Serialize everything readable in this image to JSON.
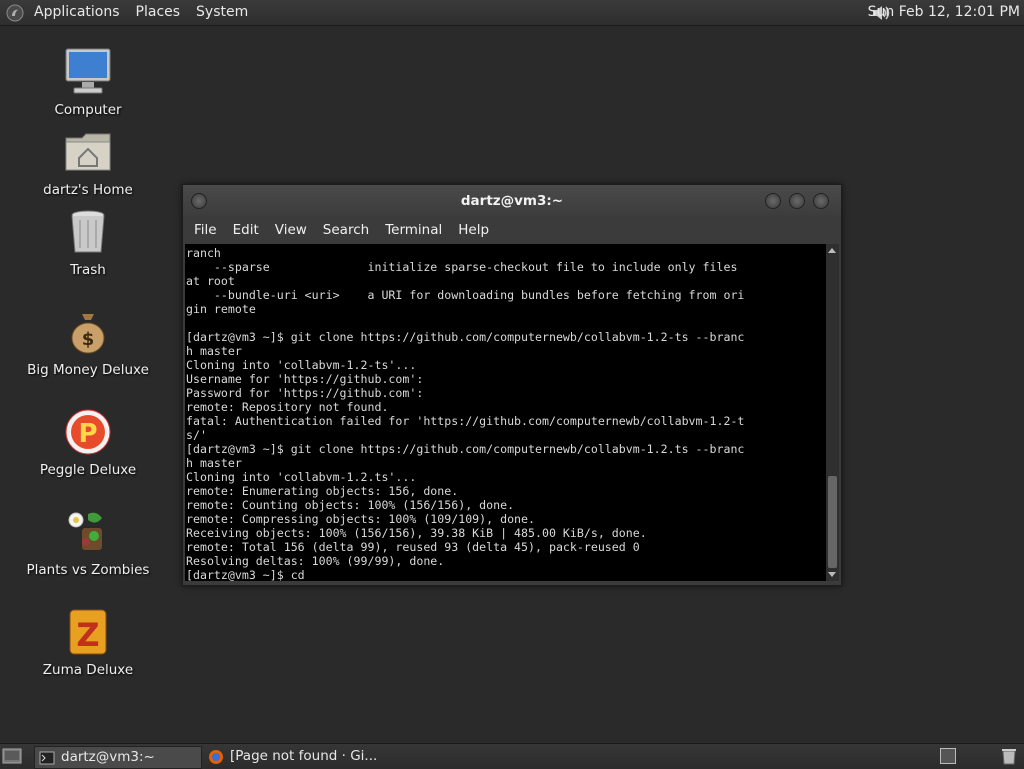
{
  "top_panel": {
    "menus": [
      "Applications",
      "Places",
      "System"
    ],
    "clock": "Sun Feb 12, 12:01 PM"
  },
  "desktop_icons": [
    {
      "label": "Computer",
      "icon": "computer-icon"
    },
    {
      "label": "dartz's Home",
      "icon": "home-folder-icon"
    },
    {
      "label": "Trash",
      "icon": "trash-icon"
    },
    {
      "label": "Big Money Deluxe",
      "icon": "money-bag-icon"
    },
    {
      "label": "Peggle Deluxe",
      "icon": "peggle-icon"
    },
    {
      "label": "Plants vs Zombies",
      "icon": "plants-icon"
    },
    {
      "label": "Zuma Deluxe",
      "icon": "zuma-icon"
    }
  ],
  "terminal": {
    "title": "dartz@vm3:~",
    "menus": [
      "File",
      "Edit",
      "View",
      "Search",
      "Terminal",
      "Help"
    ],
    "lines": [
      "ranch",
      "    --sparse              initialize sparse-checkout file to include only files",
      "at root",
      "    --bundle-uri <uri>    a URI for downloading bundles before fetching from ori",
      "gin remote",
      "",
      "[dartz@vm3 ~]$ git clone https://github.com/computernewb/collabvm-1.2-ts --branc",
      "h master",
      "Cloning into 'collabvm-1.2-ts'...",
      "Username for 'https://github.com':",
      "Password for 'https://github.com':",
      "remote: Repository not found.",
      "fatal: Authentication failed for 'https://github.com/computernewb/collabvm-1.2-t",
      "s/'",
      "[dartz@vm3 ~]$ git clone https://github.com/computernewb/collabvm-1.2.ts --branc",
      "h master",
      "Cloning into 'collabvm-1.2.ts'...",
      "remote: Enumerating objects: 156, done.",
      "remote: Counting objects: 100% (156/156), done.",
      "remote: Compressing objects: 100% (109/109), done.",
      "Receiving objects: 100% (156/156), 39.38 KiB | 485.00 KiB/s, done.",
      "remote: Total 156 (delta 99), reused 93 (delta 45), pack-reused 0",
      "Resolving deltas: 100% (99/99), done.",
      "[dartz@vm3 ~]$ cd"
    ]
  },
  "taskbar": {
    "tasks": [
      {
        "label": "dartz@vm3:~",
        "icon": "terminal-icon",
        "active": true
      },
      {
        "label": "[Page not found · Gi...",
        "icon": "firefox-icon",
        "active": false
      }
    ]
  },
  "colors": {
    "desktop_bg": "#2a2a2a",
    "panel_bg": "#333333",
    "terminal_bg": "#000000",
    "terminal_fg": "#d8d8d8"
  }
}
